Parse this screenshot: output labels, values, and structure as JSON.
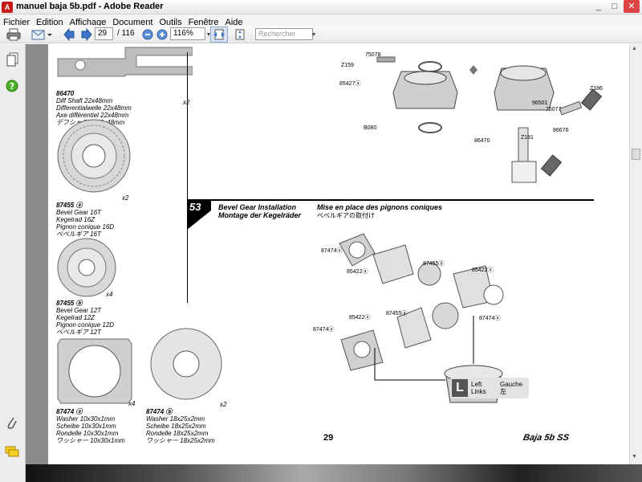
{
  "window": {
    "title": "manuel baja 5b.pdf - Adobe Reader",
    "app_icon": "A"
  },
  "window_controls": {
    "minimize": "_",
    "maximize": "□",
    "close": "✕"
  },
  "menu": [
    "Fichier",
    "Edition",
    "Affichage",
    "Document",
    "Outils",
    "Fenêtre",
    "Aide"
  ],
  "toolbar": {
    "page_current": "29",
    "page_total": "/ 116",
    "zoom": "116%",
    "search_placeholder": "Rechercher"
  },
  "page": {
    "page_number": "29",
    "brand": "Baja 5b SS",
    "parts": [
      {
        "id": "86470",
        "lines": [
          "Diff Shaft 22x48mm",
          "Differentialwelle 22x48mm",
          "Axe différentiel 22x48mm",
          "デフシャフト 22x48mm"
        ],
        "qty": "x2"
      },
      {
        "id": "87455 ⓐ",
        "lines": [
          "Bevel Gear 16T",
          "Kegelrad 16Z",
          "Pignon conique 16D",
          "ベベルギア 16T"
        ],
        "qty": "x2"
      },
      {
        "id": "87455 ⓑ",
        "lines": [
          "Bevel Gear 12T",
          "Kegelrad 12Z",
          "Pignon conique 12D",
          "ベベルギア 12T"
        ],
        "qty": "x4"
      },
      {
        "id": "87474 ⓐ",
        "lines": [
          "Washer 10x30x1mm",
          "Scheibe 10x30x1mm",
          "Rondelle 10x30x1mm",
          "ワッシャー 10x30x1mm"
        ],
        "qty": "x4"
      },
      {
        "id": "87474 ⓑ",
        "lines": [
          "Washer 18x25x2mm",
          "Scheibe 18x25x2mm",
          "Rondelle 18x25x2mm",
          "ワッシャー 18x25x2mm"
        ],
        "qty": "x2"
      }
    ],
    "step": {
      "number": "53",
      "title_en": "Bevel Gear Installation",
      "title_de": "Montage der Kegelräder",
      "title_fr": "Mise en place des pignons coniques",
      "title_jp": "ベベルギアの取付け"
    },
    "top_callouts": [
      "75078",
      "Z159",
      "85427ⓐ",
      "B080",
      "Z186",
      "96501",
      "75077",
      "86676",
      "86470",
      "Z181"
    ],
    "step_callouts": [
      "87474ⓐ",
      "85422ⓐ",
      "87455ⓑ",
      "85422ⓐ",
      "87474ⓐ",
      "85422ⓐ",
      "87455ⓐ",
      "87474ⓐ"
    ],
    "legend": {
      "letter": "L",
      "en": "Left",
      "de": "Links",
      "fr": "Gauche",
      "jp": "左"
    }
  }
}
